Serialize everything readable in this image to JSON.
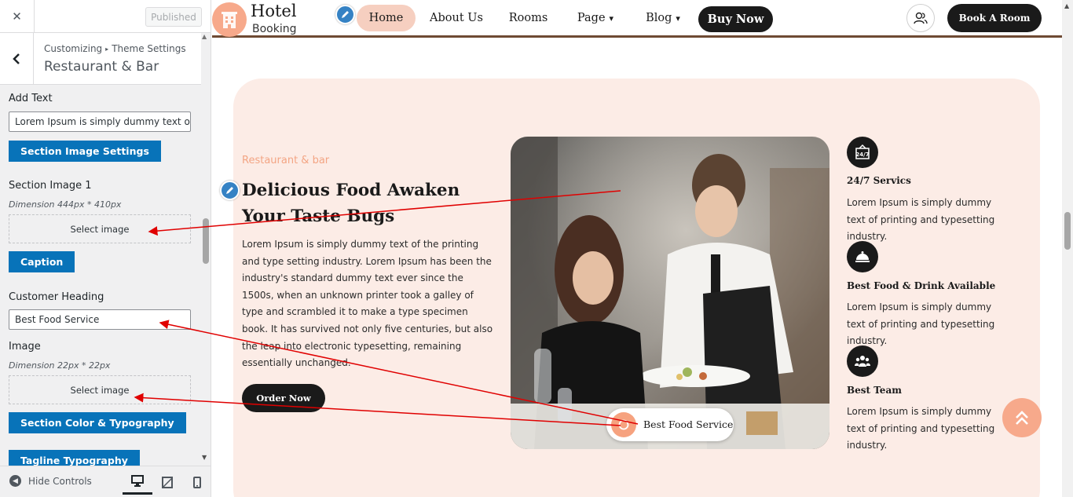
{
  "sidebar": {
    "close_icon": "close-icon",
    "published_label": "Published",
    "breadcrumb_parent": "Customizing",
    "breadcrumb_section": "Theme Settings",
    "panel_title": "Restaurant & Bar",
    "controls": {
      "add_text_label": "Add Text",
      "add_text_value": "Lorem Ipsum is simply dummy text of printing",
      "section_image_settings_label": "Section Image Settings",
      "section_image_1_label": "Section Image 1",
      "section_image_1_desc": "Dimension 444px * 410px",
      "select_image_label": "Select image",
      "caption_label": "Caption",
      "customer_heading_label": "Customer Heading",
      "customer_heading_value": "Best Food Service",
      "image_label": "Image",
      "image_desc": "Dimension 22px * 22px",
      "select_image_label_2": "Select image",
      "section_color_typography_label": "Section Color & Typography",
      "tagline_typography_label": "Tagline Typography"
    },
    "footer": {
      "hide_controls_label": "Hide Controls"
    }
  },
  "preview": {
    "logo_title": "Hotel",
    "logo_subtitle": "Booking",
    "nav": [
      {
        "label": "Home"
      },
      {
        "label": "About Us"
      },
      {
        "label": "Rooms"
      },
      {
        "label": "Page"
      },
      {
        "label": "Blog"
      }
    ],
    "buy_now_label": "Buy Now",
    "book_room_label": "Book A Room",
    "section": {
      "tagline": "Restaurant & bar",
      "heading": "Delicious Food Awaken Your Taste Bugs",
      "body": "Lorem Ipsum is simply dummy text of the printing and type setting industry. Lorem Ipsum has been the industry's standard dummy text ever since the 1500s, when an unknown printer took a galley of type and scrambled it to make a type specimen book. It has survived not only five centuries, but also the leap into electronic typesetting, remaining essentially unchanged.",
      "order_button": "Order Now",
      "caption": "Best Food Service",
      "features": [
        {
          "icon": "24-7-icon",
          "title": "24/7 Servics",
          "text": "Lorem Ipsum is simply dummy text of printing and typesetting industry."
        },
        {
          "icon": "food-tray-icon",
          "title": "Best Food & Drink Available",
          "text": "Lorem Ipsum is simply dummy text of printing and typesetting industry."
        },
        {
          "icon": "team-icon",
          "title": "Best Team",
          "text": "Lorem Ipsum is simply dummy text of printing and typesetting industry."
        }
      ]
    }
  },
  "colors": {
    "accent": "#f7a98b",
    "section_bg": "#fcece6",
    "customizer_button": "#0873b9",
    "dark": "#1a1a1a",
    "annotation_arrow": "#e00000"
  }
}
